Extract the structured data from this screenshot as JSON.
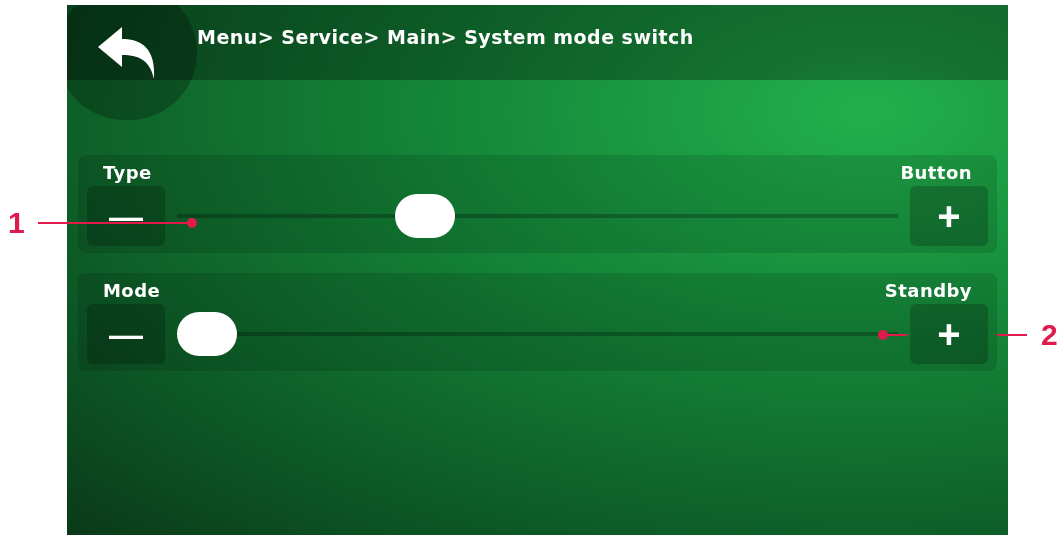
{
  "header": {
    "breadcrumb": "Menu> Service> Main> System mode switch"
  },
  "settings": [
    {
      "label": "Type",
      "value": "Button",
      "level": 0.33,
      "minus": "—",
      "plus": "+"
    },
    {
      "label": "Mode",
      "value": "Standby",
      "level": 0.0,
      "minus": "—",
      "plus": "+"
    }
  ],
  "callouts": [
    {
      "number": "1"
    },
    {
      "number": "2"
    }
  ]
}
